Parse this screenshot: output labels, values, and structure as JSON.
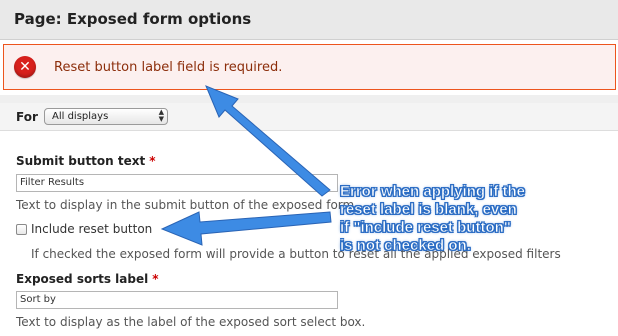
{
  "page": {
    "title": "Page: Exposed form options"
  },
  "error": {
    "message": "Reset button label field is required.",
    "icon": "error-x-icon",
    "color": "#d8201c"
  },
  "for_row": {
    "label": "For",
    "selected": "All displays"
  },
  "submit": {
    "label": "Submit button text",
    "required_mark": "*",
    "value": "Filter Results",
    "description": "Text to display in the submit button of the exposed form."
  },
  "reset": {
    "checkbox_label": "Include reset button",
    "checked": false,
    "description": "If checked the exposed form will provide a button to reset all the applied exposed filters"
  },
  "sorts": {
    "label": "Exposed sorts label",
    "required_mark": "*",
    "value": "Sort by",
    "description": "Text to display as the label of the exposed sort select box."
  },
  "annotation": {
    "lines": [
      "Error when applying if the",
      "reset label is blank, even",
      "if \"include reset button\"",
      "is not checked on."
    ],
    "arrow_color": "#3d8be4"
  }
}
